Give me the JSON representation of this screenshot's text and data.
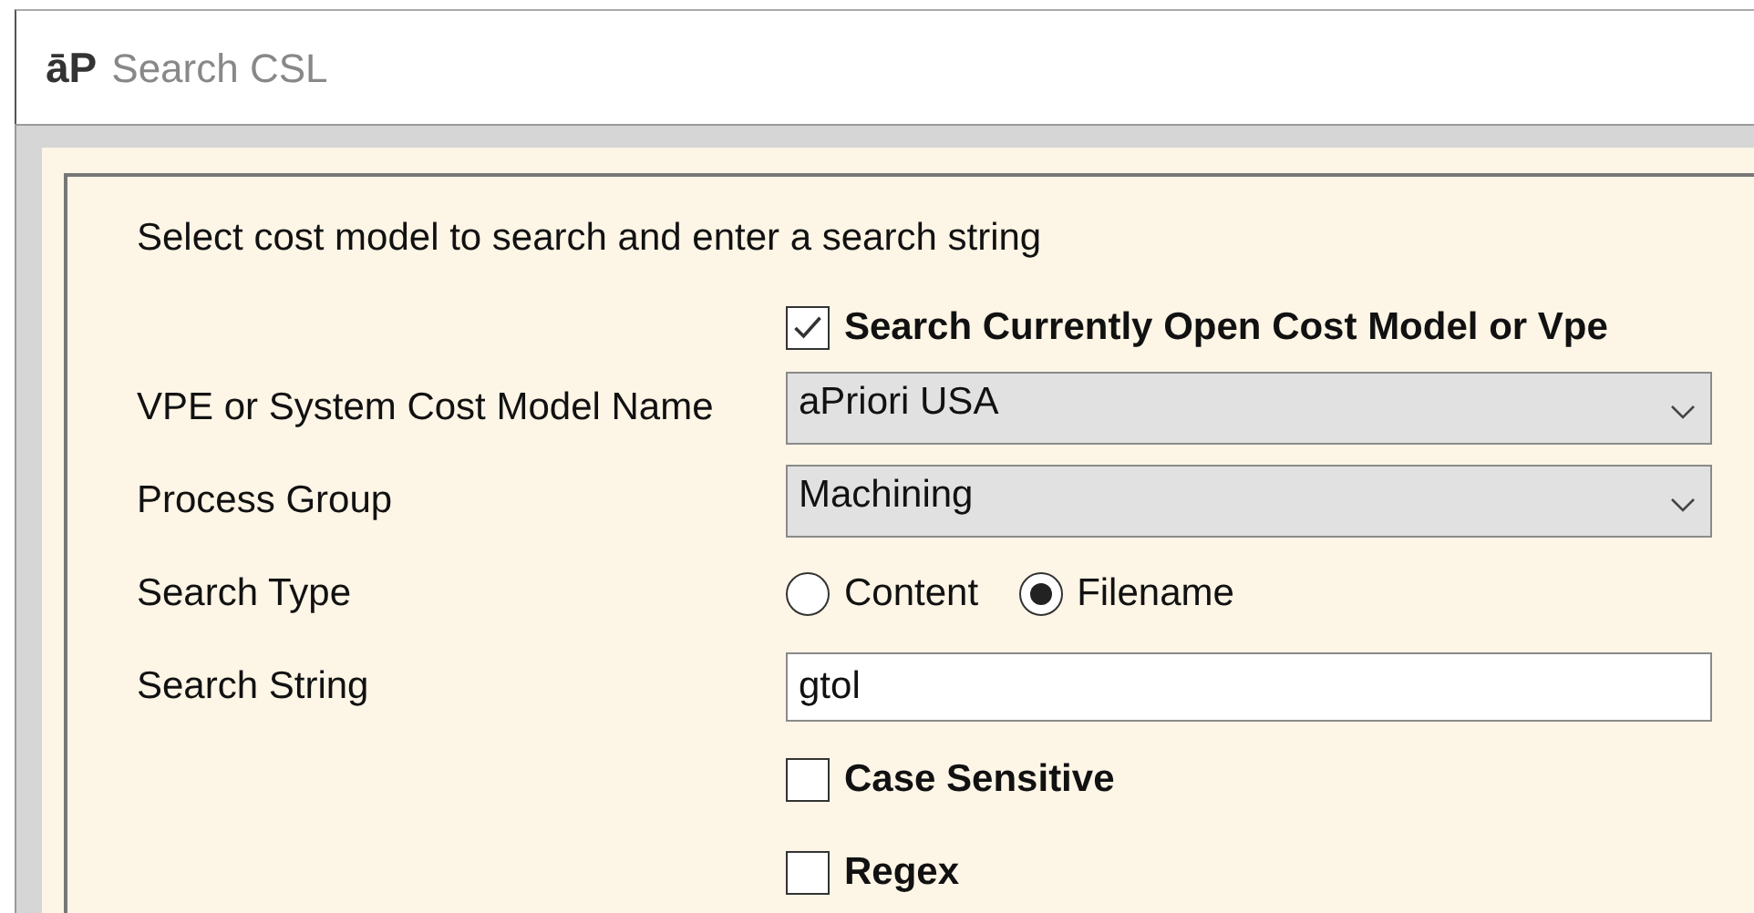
{
  "window": {
    "logo": "āP",
    "title": "Search CSL"
  },
  "instruction": "Select cost model to search and enter a search string",
  "fields": [
    {
      "kind": "checkbox",
      "text": "Search Currently Open Cost Model or Vpe",
      "checked": true
    },
    {
      "kind": "select",
      "label": "VPE or System Cost Model Name",
      "value": "aPriori USA"
    },
    {
      "kind": "select",
      "label": "Process Group",
      "value": "Machining"
    },
    {
      "kind": "radio",
      "label": "Search Type",
      "options": [
        {
          "text": "Content",
          "selected": false
        },
        {
          "text": "Filename",
          "selected": true
        }
      ]
    },
    {
      "kind": "text",
      "label": "Search String",
      "value": "gtol"
    },
    {
      "kind": "checkbox",
      "text": "Case Sensitive",
      "checked": false
    },
    {
      "kind": "checkbox",
      "text": "Regex",
      "checked": false
    }
  ]
}
